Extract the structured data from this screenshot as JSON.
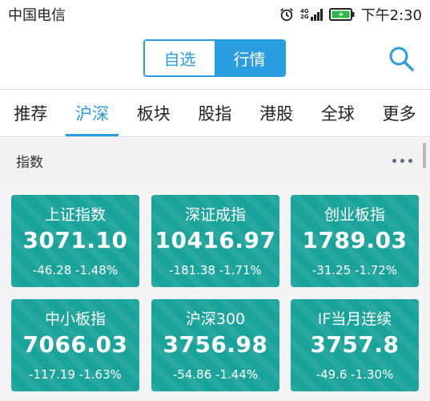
{
  "status_bar": {
    "carrier": "中国电信",
    "network_label_top": "4G",
    "network_label_bottom": "2G",
    "time": "下午2:30"
  },
  "header": {
    "tabs": [
      {
        "label": "自选",
        "active": false
      },
      {
        "label": "行情",
        "active": true
      }
    ]
  },
  "nav": {
    "tabs": [
      {
        "label": "推荐",
        "active": false
      },
      {
        "label": "沪深",
        "active": true
      },
      {
        "label": "板块",
        "active": false
      },
      {
        "label": "股指",
        "active": false
      },
      {
        "label": "港股",
        "active": false
      },
      {
        "label": "全球",
        "active": false
      },
      {
        "label": "更多",
        "active": false
      }
    ]
  },
  "section": {
    "title": "指数"
  },
  "cards": [
    {
      "name": "上证指数",
      "value": "3071.10",
      "change": "-46.28",
      "percent": "-1.48%"
    },
    {
      "name": "深证成指",
      "value": "10416.97",
      "change": "-181.38",
      "percent": "-1.71%"
    },
    {
      "name": "创业板指",
      "value": "1789.03",
      "change": "-31.25",
      "percent": "-1.72%"
    },
    {
      "name": "中小板指",
      "value": "7066.03",
      "change": "-117.19",
      "percent": "-1.63%"
    },
    {
      "name": "沪深300",
      "value": "3756.98",
      "change": "-54.86",
      "percent": "-1.44%"
    },
    {
      "name": "IF当月连续",
      "value": "3757.8",
      "change": "-49.6",
      "percent": "-1.30%"
    }
  ],
  "colors": {
    "accent": "#2a9de0",
    "card": "#1aa39a"
  }
}
